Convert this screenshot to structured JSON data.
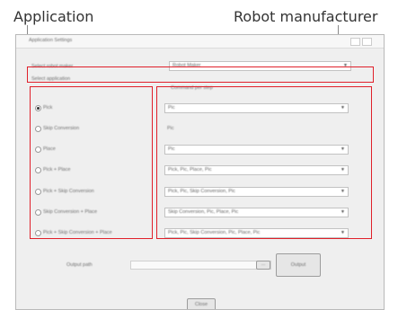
{
  "callouts": {
    "application": "Application",
    "robot_manufacturer": "Robot manufacturer"
  },
  "window": {
    "title": "Application Settings"
  },
  "robot": {
    "label": "Select robot maker",
    "value": "Robot Maker"
  },
  "application": {
    "header": "Select application",
    "options": [
      {
        "label": "Pick",
        "selected": true
      },
      {
        "label": "Skip Conversion",
        "selected": false
      },
      {
        "label": "Place",
        "selected": false
      },
      {
        "label": "Pick + Place",
        "selected": false
      },
      {
        "label": "Pick + Skip Conversion",
        "selected": false
      },
      {
        "label": "Skip Conversion + Place",
        "selected": false
      },
      {
        "label": "Pick + Skip Conversion + Place",
        "selected": false
      }
    ]
  },
  "commands": {
    "header": "Command per step",
    "rows": [
      {
        "value": "Pic",
        "kind": "combo"
      },
      {
        "value": "Pic",
        "kind": "text"
      },
      {
        "value": "Pic",
        "kind": "combo"
      },
      {
        "value": "Pick, Pic, Place, Pic",
        "kind": "combo"
      },
      {
        "value": "Pick, Pic, Skip Conversion, Pic",
        "kind": "combo"
      },
      {
        "value": "Skip Conversion, Pic, Place, Pic",
        "kind": "combo"
      },
      {
        "value": "Pick, Pic, Skip Conversion, Pic, Place, Pic",
        "kind": "combo"
      }
    ]
  },
  "output": {
    "label": "Output path",
    "browse_label": "...",
    "output_button": "Output"
  },
  "footer": {
    "close_button": "Close"
  },
  "colors": {
    "highlight_red": "#e0202a",
    "window_bg": "#efefef"
  }
}
